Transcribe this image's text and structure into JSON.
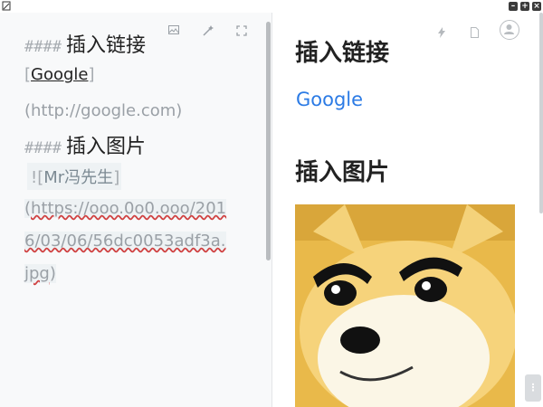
{
  "editor": {
    "heading1": {
      "hashes": "####",
      "text": "插入链接"
    },
    "link": {
      "open": "[",
      "text": "Google",
      "close": "]",
      "url": "(http://google.com)"
    },
    "heading2": {
      "hashes": "####",
      "text": "插入图片"
    },
    "image": {
      "prefix": "![",
      "alt": "Mr冯先生",
      "suffix": "]",
      "url_open": "(",
      "url_line1": "https://ooo.0o0.ooo/201",
      "url_line2": "6/03/06/56dc0053adf3a.",
      "url_line3": "jpg",
      "url_close": ")"
    },
    "toolbar_icons": [
      "image-icon",
      "magic-wand-icon",
      "fullscreen-icon"
    ]
  },
  "preview": {
    "heading1": "插入链接",
    "link_text": "Google",
    "heading2": "插入图片",
    "toolbar_icons": [
      "bolt-icon",
      "document-icon",
      "user-avatar-icon"
    ]
  },
  "window": {
    "buttons": [
      "minimize",
      "maximize",
      "close"
    ]
  },
  "colors": {
    "link": "#2c7be5",
    "editor_bg": "#f8f9fa",
    "muted": "#9aa0a6",
    "heading": "#222222"
  }
}
